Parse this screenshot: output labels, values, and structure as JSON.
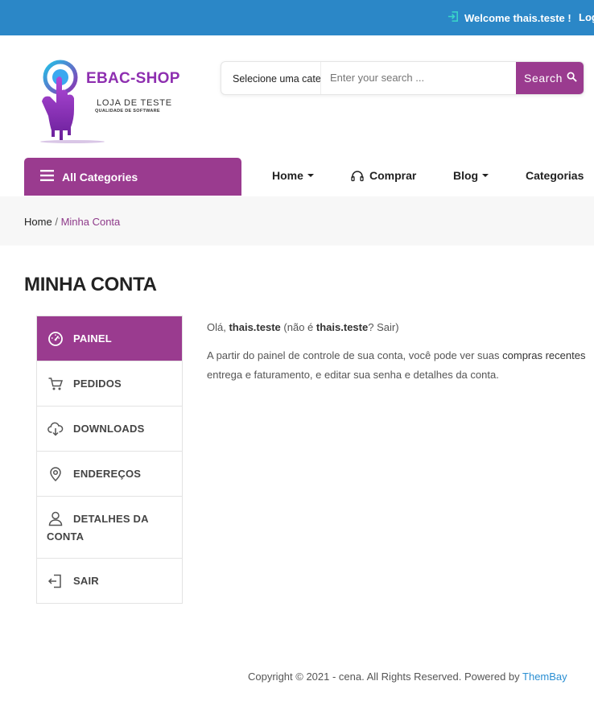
{
  "topbar": {
    "welcome": "Welcome thais.teste !",
    "logout": "Log"
  },
  "logo": {
    "title": "EBAC-SHOP",
    "subtitle": "LOJA DE TESTE",
    "tagline": "QUALIDADE DE SOFTWARE"
  },
  "search": {
    "category": "Selecione uma categoria",
    "placeholder": "Enter your search ...",
    "button": "Search"
  },
  "nav": {
    "all_categories": "All Categories",
    "items": [
      {
        "label": "Home"
      },
      {
        "label": "Comprar"
      },
      {
        "label": "Blog"
      },
      {
        "label": "Categorias"
      }
    ]
  },
  "breadcrumb": {
    "home": "Home",
    "separator": "/",
    "current": "Minha Conta"
  },
  "page_title": "MINHA CONTA",
  "account_menu": [
    {
      "label": "PAINEL",
      "icon": "dashboard-icon",
      "active": true
    },
    {
      "label": "PEDIDOS",
      "icon": "cart-icon"
    },
    {
      "label": "DOWNLOADS",
      "icon": "cloud-download-icon"
    },
    {
      "label": "ENDEREÇOS",
      "icon": "location-pin-icon"
    },
    {
      "label": "DETALHES DA",
      "label_line2": "CONTA",
      "icon": "user-icon"
    },
    {
      "label": "SAIR",
      "icon": "logout-icon"
    }
  ],
  "content": {
    "hello": "Olá,",
    "username": "thais.teste",
    "not_you_open": "(não é",
    "not_you_user": "thais.teste",
    "not_you_close": "?",
    "sair_link": "Sair)",
    "intro": "A partir do painel de controle de sua conta, você pode ver suas",
    "orders_link": "compras recentes",
    "line2": "entrega e faturamento, e editar sua senha e detalhes da conta."
  },
  "footer": {
    "text": "Copyright © 2021 - cena. All Rights Reserved. Powered by",
    "link": "ThemBay"
  },
  "colors": {
    "topbar": "#2b87c7",
    "brand_purple": "#9a3b8f",
    "link_blue": "#2b8fd3"
  }
}
